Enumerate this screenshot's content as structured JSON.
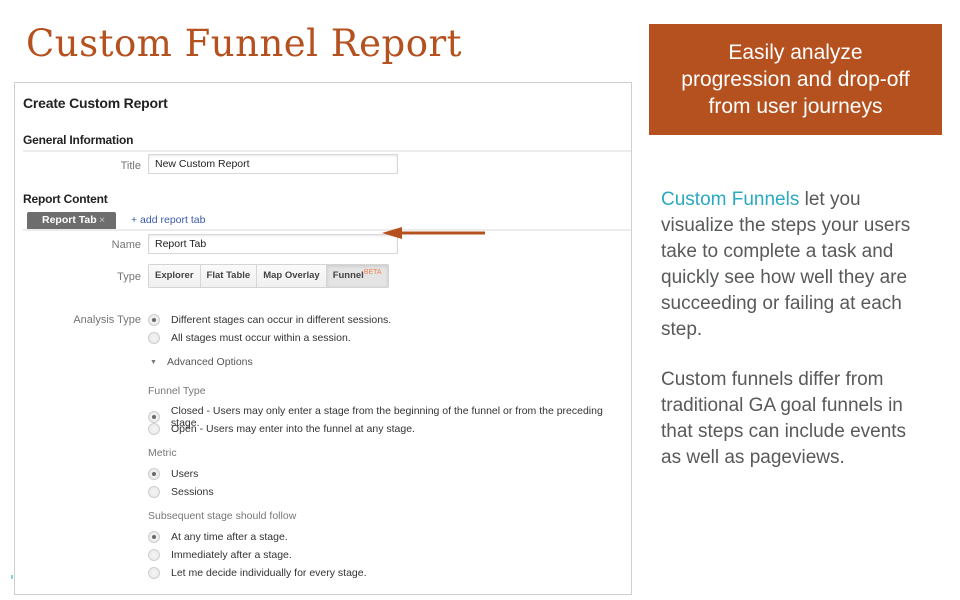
{
  "slide": {
    "title": "Custom Funnel Report",
    "callout": {
      "lines": [
        "Easily analyze",
        "progression and drop-off",
        "from user journeys"
      ],
      "background": "#b5501f"
    },
    "description_1": {
      "highlight": "Custom Funnels",
      "rest": " let you visualize the steps your users take to complete a task and quickly see how well they are succeeding or failing at each step.",
      "highlight_color": "#2ba9c0"
    },
    "description_2": "Custom funnels differ from traditional GA goal funnels in that steps can include events as well as pageviews."
  },
  "ga_form": {
    "heading": "Create Custom Report",
    "general_information": {
      "heading": "General Information",
      "title_label": "Title",
      "title_value": "New Custom Report"
    },
    "report_content": {
      "heading": "Report Content",
      "active_tab": "Report Tab",
      "tab_close": "×",
      "add_tab_link": "+ add report tab",
      "name_label": "Name",
      "name_value": "Report Tab",
      "type_label": "Type",
      "type_options": [
        {
          "label": "Explorer",
          "active": false
        },
        {
          "label": "Flat Table",
          "active": false
        },
        {
          "label": "Map Overlay",
          "active": false
        },
        {
          "label": "Funnel",
          "active": true,
          "badge": "BETA"
        }
      ]
    },
    "analysis_type": {
      "label": "Analysis Type",
      "options": [
        {
          "label": "Different stages can occur in different sessions.",
          "checked": true
        },
        {
          "label": "All stages must occur within a session.",
          "checked": false
        }
      ]
    },
    "advanced_options": {
      "label": "Advanced Options",
      "caret": "▼"
    },
    "funnel_type": {
      "label": "Funnel Type",
      "options": [
        {
          "label": "Closed - Users may only enter a stage from the beginning of the funnel or from the preceding stage.",
          "checked": true
        },
        {
          "label": "Open - Users may enter into the funnel at any stage.",
          "checked": false
        }
      ]
    },
    "metric": {
      "label": "Metric",
      "options": [
        {
          "label": "Users",
          "checked": true
        },
        {
          "label": "Sessions",
          "checked": false
        }
      ]
    },
    "subsequent_stage": {
      "label": "Subsequent stage should follow",
      "options": [
        {
          "label": "At any time after a stage.",
          "checked": true
        },
        {
          "label": "Immediately after a stage.",
          "checked": false
        },
        {
          "label": "Let me decide individually for every stage.",
          "checked": false
        }
      ]
    }
  },
  "annotation_arrow": {
    "color": "#b5501f",
    "points_to": "Report Tab name field"
  }
}
